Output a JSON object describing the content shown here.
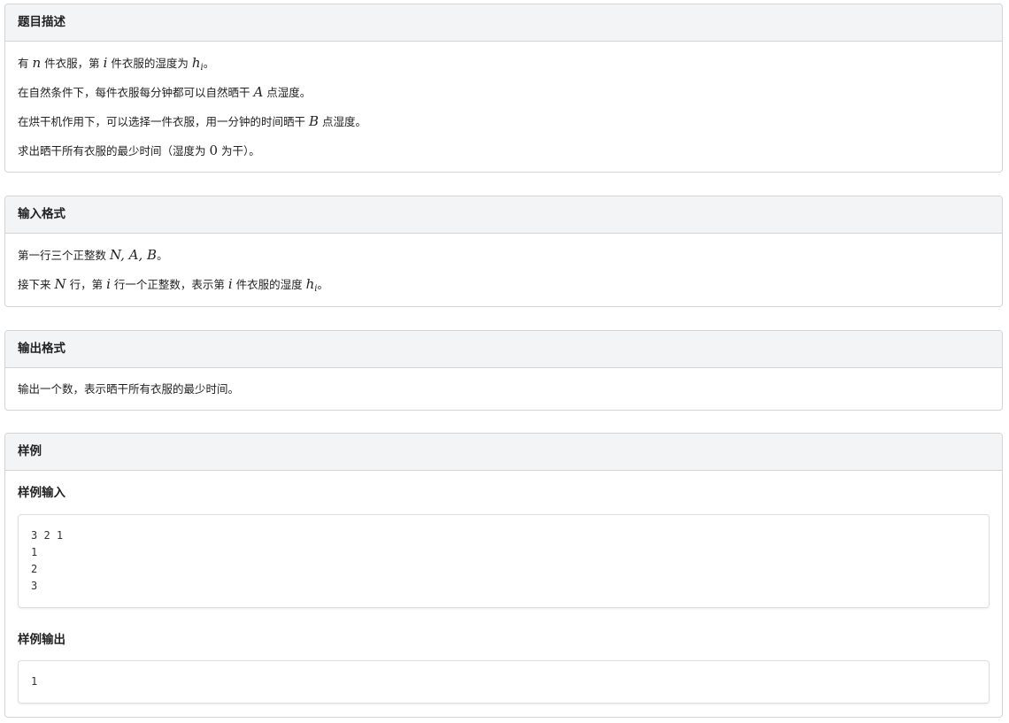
{
  "description": {
    "title": "题目描述",
    "line1": {
      "pre": "有 ",
      "n": "n",
      "mid1": " 件衣服，第 ",
      "i": "i",
      "mid2": " 件衣服的湿度为 ",
      "h": "h",
      "hsub": "i",
      "end": "。"
    },
    "line2": {
      "pre": "在自然条件下，每件衣服每分钟都可以自然晒干 ",
      "A": "A",
      "end": " 点湿度。"
    },
    "line3": {
      "pre": "在烘干机作用下，可以选择一件衣服，用一分钟的时间晒干 ",
      "B": "B",
      "end": " 点湿度。"
    },
    "line4": {
      "pre": "求出晒干所有衣服的最少时间（湿度为 ",
      "zero": "0",
      "end": " 为干）。"
    }
  },
  "input_format": {
    "title": "输入格式",
    "line1": {
      "pre": "第一行三个正整数 ",
      "math": "N, A, B",
      "end": "。"
    },
    "line2": {
      "pre": "接下来 ",
      "N": "N",
      "mid1": " 行，第 ",
      "i": "i",
      "mid2": " 行一个正整数，表示第 ",
      "i2": "i",
      "mid3": " 件衣服的湿度 ",
      "h": "h",
      "hsub": "i",
      "end": "。"
    }
  },
  "output_format": {
    "title": "输出格式",
    "line1": "输出一个数，表示晒干所有衣服的最少时间。"
  },
  "samples": {
    "title": "样例",
    "input_title": "样例输入",
    "input_text": "3 2 1\n1\n2\n3",
    "output_title": "样例输出",
    "output_text": "1"
  }
}
